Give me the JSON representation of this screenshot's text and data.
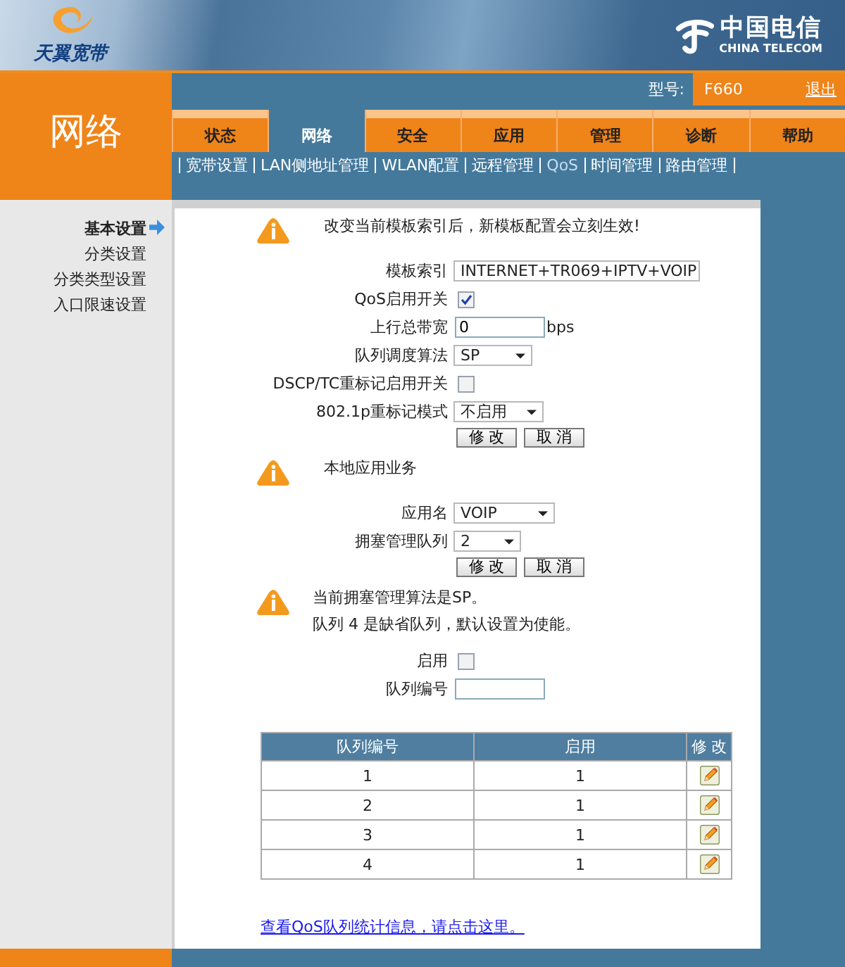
{
  "header": {
    "product_logo": "天翼宽带",
    "brand_name": "中国电信",
    "brand_subtitle": "CHINA TELECOM"
  },
  "section_title": "网络",
  "model": {
    "label": "型号:",
    "value": "F660",
    "logout": "退出"
  },
  "tabs": [
    {
      "label": "状态",
      "selected": false
    },
    {
      "label": "网络",
      "selected": true
    },
    {
      "label": "安全",
      "selected": false
    },
    {
      "label": "应用",
      "selected": false
    },
    {
      "label": "管理",
      "selected": false
    },
    {
      "label": "诊断",
      "selected": false
    },
    {
      "label": "帮助",
      "selected": false
    }
  ],
  "subnav": [
    {
      "label": "宽带设置",
      "selected": false
    },
    {
      "label": "LAN侧地址管理",
      "selected": false
    },
    {
      "label": "WLAN配置",
      "selected": false
    },
    {
      "label": "远程管理",
      "selected": false
    },
    {
      "label": "QoS",
      "selected": true
    },
    {
      "label": "时间管理",
      "selected": false
    },
    {
      "label": "路由管理",
      "selected": false
    }
  ],
  "sidebar": {
    "items": [
      {
        "label": "基本设置",
        "selected": true
      },
      {
        "label": "分类设置",
        "selected": false
      },
      {
        "label": "分类类型设置",
        "selected": false
      },
      {
        "label": "入口限速设置",
        "selected": false
      }
    ]
  },
  "template_section": {
    "notice": [
      "改变当前模板索引后，新模板配置会立刻生效!"
    ],
    "fields": [
      {
        "kind": "select",
        "label": "模板索引",
        "value": "INTERNET+TR069+IPTV+VOIP"
      },
      {
        "kind": "checkbox",
        "label": "QoS启用开关",
        "checked": true
      },
      {
        "kind": "text",
        "label": "上行总带宽",
        "value": "0",
        "unit": "bps"
      },
      {
        "kind": "select",
        "label": "队列调度算法",
        "value": "SP"
      },
      {
        "kind": "checkbox",
        "label": "DSCP/TC重标记启用开关",
        "checked": false
      },
      {
        "kind": "select",
        "label": "802.1p重标记模式",
        "value": "不启用"
      }
    ],
    "buttons": [
      "修 改",
      "取 消"
    ]
  },
  "app_section": {
    "notice": [
      "本地应用业务"
    ],
    "fields": [
      {
        "kind": "select",
        "label": "应用名",
        "value": "VOIP"
      },
      {
        "kind": "select",
        "label": "拥塞管理队列",
        "value": "2"
      }
    ],
    "buttons": [
      "修 改",
      "取 消"
    ]
  },
  "queue_section": {
    "notice": [
      "当前拥塞管理算法是SP。",
      "队列 4 是缺省队列，默认设置为使能。"
    ],
    "fields": [
      {
        "kind": "checkbox",
        "label": "启用",
        "checked": false
      },
      {
        "kind": "text",
        "label": "队列编号"
      }
    ]
  },
  "queue_table": {
    "columns": [
      "队列编号",
      "启用",
      "修 改"
    ],
    "rows": [
      {
        "cells": [
          "1",
          "1"
        ]
      },
      {
        "cells": [
          "2",
          "1"
        ]
      },
      {
        "cells": [
          "3",
          "1"
        ]
      },
      {
        "cells": [
          "4",
          "1"
        ]
      }
    ]
  },
  "stats_link": "查看QoS队列统计信息，请点击这里。"
}
